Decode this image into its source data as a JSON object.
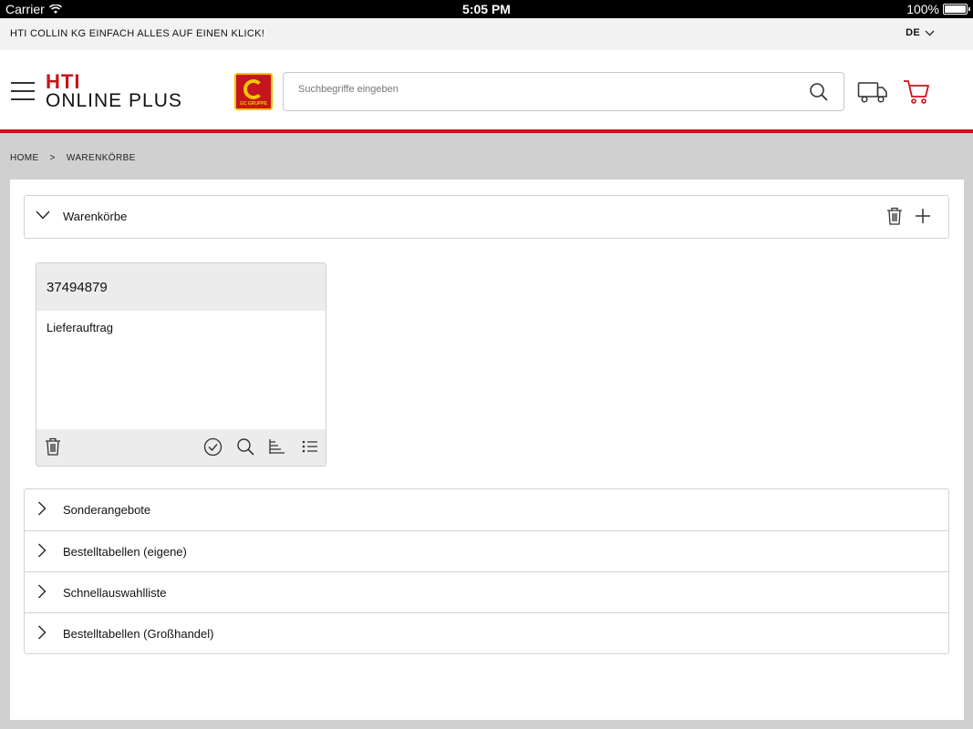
{
  "status_bar": {
    "carrier": "Carrier",
    "time": "5:05 PM",
    "battery": "100%"
  },
  "topbar": {
    "slogan": "HTI COLLIN KG EINFACH ALLES AUF EINEN KLICK!",
    "language": "DE"
  },
  "header": {
    "brand_line1": "HTI",
    "brand_line2": "ONLINE PLUS",
    "logo_caption": "GC GRUPPE",
    "search_placeholder": "Suchbegriffe eingeben",
    "accent_color": "#c4161c"
  },
  "breadcrumb": {
    "home": "HOME",
    "separator": ">",
    "current": "WARENKÖRBE"
  },
  "warenkoerbe": {
    "title": "Warenkörbe",
    "card": {
      "number": "37494879",
      "description": "Lieferauftrag"
    }
  },
  "accordion": [
    {
      "label": "Sonderangebote"
    },
    {
      "label": "Bestelltabellen (eigene)"
    },
    {
      "label": "Schnellauswahlliste"
    },
    {
      "label": "Bestelltabellen (Großhandel)"
    }
  ]
}
